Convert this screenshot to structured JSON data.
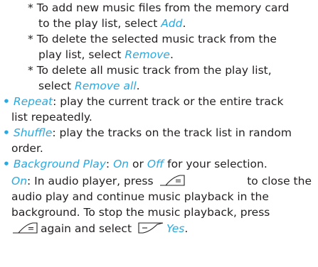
{
  "sub_items": [
    {
      "star": "*",
      "l1": "To add new music files from the memory card",
      "l2a": "to the play list, select ",
      "l2_hl": "Add",
      "l2b": "."
    },
    {
      "star": "*",
      "l1": "To delete the selected music track from the",
      "l2a": "play list, select ",
      "l2_hl": "Remove",
      "l2b": "."
    },
    {
      "star": "*",
      "l1": "To delete all music track from the play list,",
      "l2a": "select ",
      "l2_hl": "Remove all",
      "l2b": "."
    }
  ],
  "bullets": {
    "marker": "•",
    "repeat": {
      "term": "Repeat",
      "l1": ": play the current track or the entire track",
      "l2": "list repeatedly."
    },
    "shuffle": {
      "term": "Shuffle",
      "l1": ": play the tracks on the track list in random",
      "l2": "order."
    },
    "background": {
      "term": "Background Play",
      "sep": ": ",
      "on": "On",
      "or": " or ",
      "off": "Off",
      "tail": " for your selection."
    }
  },
  "background_detail": {
    "on_label": "On",
    "l1a": ": In audio player, press",
    "l1b": "to close the",
    "l2": "audio play and continue music playback in the",
    "l3": "background. To stop the music playback, press",
    "l4a": "again and select",
    "yes": "Yes",
    "l4b": "."
  },
  "colors": {
    "accent": "#29a9e0",
    "text": "#231f20"
  },
  "icons": {
    "end_key": "hangup-key-icon",
    "left_soft_key": "left-softkey-icon"
  }
}
